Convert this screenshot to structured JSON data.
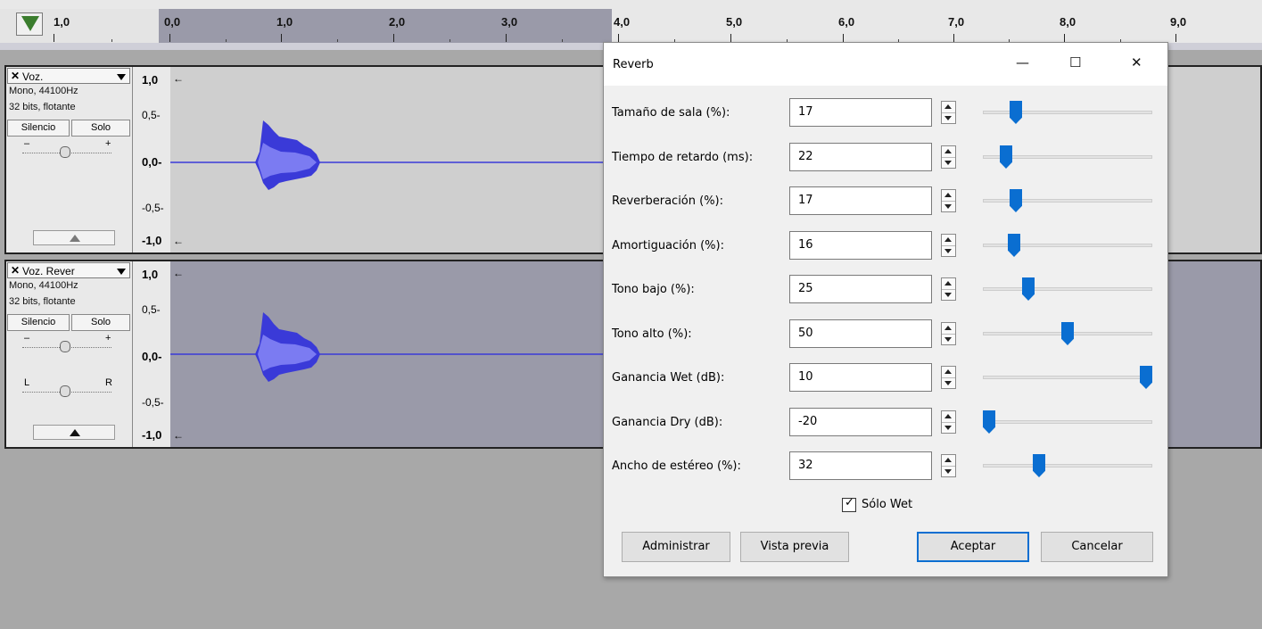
{
  "ruler": {
    "labels": [
      "1,0",
      "0,0",
      "1,0",
      "2,0",
      "3,0",
      "4,0",
      "5,0",
      "6,0",
      "7,0",
      "8,0",
      "9,0"
    ]
  },
  "tracks": [
    {
      "name": "Voz.",
      "info1": "Mono, 44100Hz",
      "info2": "32 bits, flotante",
      "mute_label": "Silencio",
      "solo_label": "Solo",
      "gain_minus": "–",
      "gain_plus": "+",
      "scale": [
        "1,0",
        "0,5-",
        "0,0-",
        "-0,5-",
        "-1,0"
      ]
    },
    {
      "name": "Voz. Rever",
      "info1": "Mono, 44100Hz",
      "info2": "32 bits, flotante",
      "mute_label": "Silencio",
      "solo_label": "Solo",
      "gain_minus": "–",
      "gain_plus": "+",
      "pan_left": "L",
      "pan_right": "R",
      "scale": [
        "1,0",
        "0,5-",
        "0,0-",
        "-0,5-",
        "-1,0"
      ]
    }
  ],
  "dialog": {
    "title": "Reverb",
    "minimize": "—",
    "maximize": "☐",
    "close": "✕",
    "params": [
      {
        "label": "Tamaño de sala (%):",
        "value": "17",
        "level": 0.17
      },
      {
        "label": "Tiempo de retardo (ms):",
        "value": "22",
        "level": 0.11
      },
      {
        "label": "Reverberación (%):",
        "value": "17",
        "level": 0.17
      },
      {
        "label": "Amortiguación (%):",
        "value": "16",
        "level": 0.16
      },
      {
        "label": "Tono bajo (%):",
        "value": "25",
        "level": 0.25
      },
      {
        "label": "Tono alto (%):",
        "value": "50",
        "level": 0.5
      },
      {
        "label": "Ganancia Wet (dB):",
        "value": "10",
        "level": 1.0
      },
      {
        "label": "Ganancia Dry (dB):",
        "value": "-20",
        "level": 0.0
      },
      {
        "label": "Ancho de estéreo (%):",
        "value": "32",
        "level": 0.32
      }
    ],
    "wet_only_label": "Sólo Wet",
    "wet_only_checked": true,
    "buttons": {
      "manage": "Administrar",
      "preview": "Vista previa",
      "ok": "Aceptar",
      "cancel": "Cancelar"
    }
  },
  "colors": {
    "accent": "#0a6ed1",
    "wave_dark": "#3a3ad8",
    "wave_light": "#6f6ff0",
    "selection": "#9a9aa9"
  }
}
